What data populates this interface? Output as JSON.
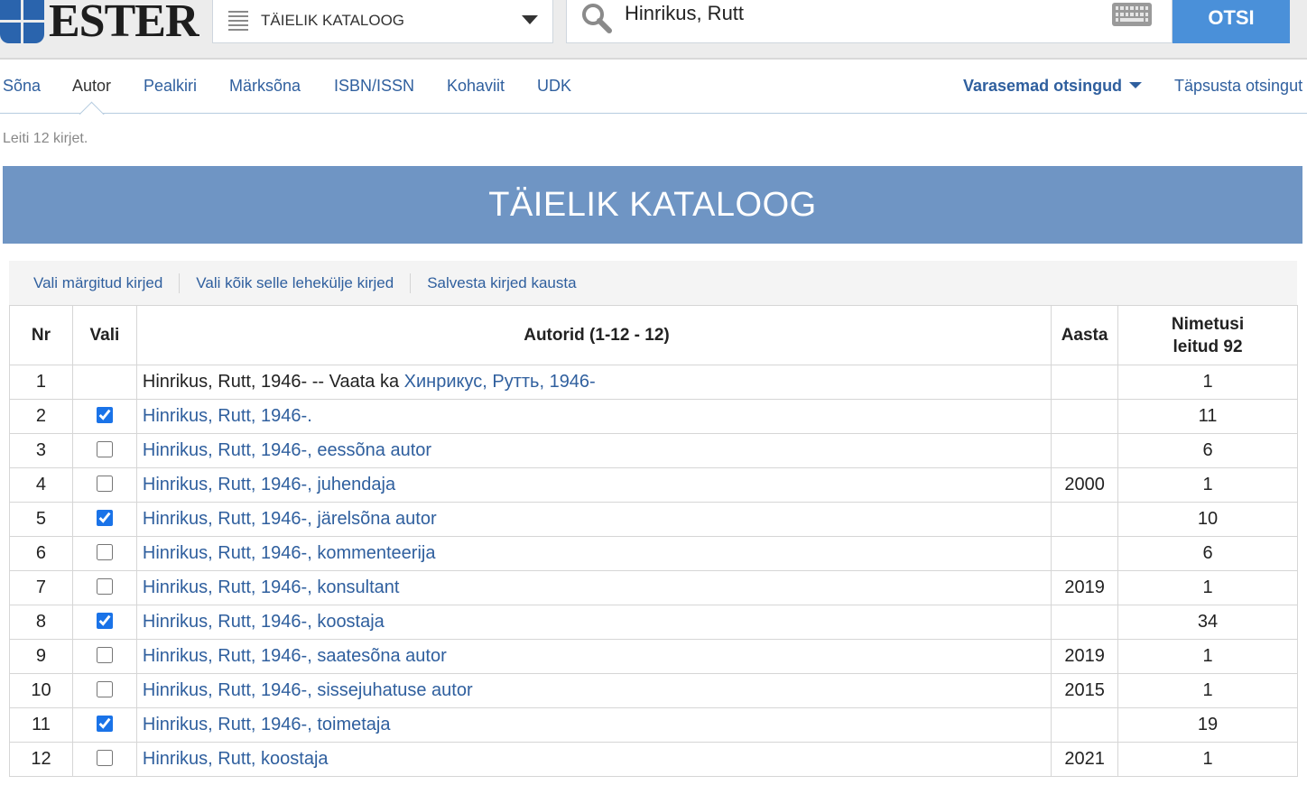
{
  "header": {
    "logo_text": "ESTER",
    "catalog_select": {
      "label": "TÄIELIK KATALOOG"
    },
    "search": {
      "value": "Hinrikus, Rutt",
      "placeholder": ""
    },
    "search_button": "OTSI"
  },
  "tabs": {
    "items": [
      {
        "label": "Sõna"
      },
      {
        "label": "Autor",
        "active": true
      },
      {
        "label": "Pealkiri"
      },
      {
        "label": "Märksõna"
      },
      {
        "label": "ISBN/ISSN"
      },
      {
        "label": "Kohaviit"
      },
      {
        "label": "UDK"
      }
    ],
    "previous_searches": "Varasemad otsingud",
    "refine": "Täpsusta otsingut"
  },
  "found_text": "Leiti 12 kirjet.",
  "banner_title": "TÄIELIK KATALOOG",
  "actions": {
    "select_marked": "Vali märgitud kirjed",
    "select_all_page": "Vali kõik selle lehekülje kirjed",
    "save_to_folder": "Salvesta kirjed kausta"
  },
  "table": {
    "headers": {
      "nr": "Nr",
      "vali": "Vali",
      "authors": "Autorid (1-12 - 12)",
      "year": "Aasta",
      "count_line1": "Nimetusi",
      "count_line2": "leitud 92"
    },
    "rows": [
      {
        "nr": "1",
        "checkbox": null,
        "text": "Hinrikus, Rutt, 1946- -- Vaata ka ",
        "link": "Хинрикус, Рутть, 1946-",
        "year": "",
        "count": "1"
      },
      {
        "nr": "2",
        "checkbox": true,
        "link": "Hinrikus, Rutt, 1946-.",
        "year": "",
        "count": "11"
      },
      {
        "nr": "3",
        "checkbox": false,
        "link": "Hinrikus, Rutt, 1946-, eessõna autor",
        "year": "",
        "count": "6"
      },
      {
        "nr": "4",
        "checkbox": false,
        "link": "Hinrikus, Rutt, 1946-, juhendaja",
        "year": "2000",
        "count": "1"
      },
      {
        "nr": "5",
        "checkbox": true,
        "link": "Hinrikus, Rutt, 1946-, järelsõna autor",
        "year": "",
        "count": "10"
      },
      {
        "nr": "6",
        "checkbox": false,
        "link": "Hinrikus, Rutt, 1946-, kommenteerija",
        "year": "",
        "count": "6"
      },
      {
        "nr": "7",
        "checkbox": false,
        "link": "Hinrikus, Rutt, 1946-, konsultant",
        "year": "2019",
        "count": "1"
      },
      {
        "nr": "8",
        "checkbox": true,
        "link": "Hinrikus, Rutt, 1946-, koostaja",
        "year": "",
        "count": "34"
      },
      {
        "nr": "9",
        "checkbox": false,
        "link": "Hinrikus, Rutt, 1946-, saatesõna autor",
        "year": "2019",
        "count": "1"
      },
      {
        "nr": "10",
        "checkbox": false,
        "link": "Hinrikus, Rutt, 1946-, sissejuhatuse autor",
        "year": "2015",
        "count": "1"
      },
      {
        "nr": "11",
        "checkbox": true,
        "link": "Hinrikus, Rutt, 1946-, toimetaja",
        "year": "",
        "count": "19"
      },
      {
        "nr": "12",
        "checkbox": false,
        "link": "Hinrikus, Rutt, koostaja",
        "year": "2021",
        "count": "1"
      }
    ]
  },
  "colors": {
    "link": "#2f5f9e",
    "banner": "#6f95c4",
    "search_button": "#4a90d9",
    "logo_blue": "#2a64ad"
  }
}
